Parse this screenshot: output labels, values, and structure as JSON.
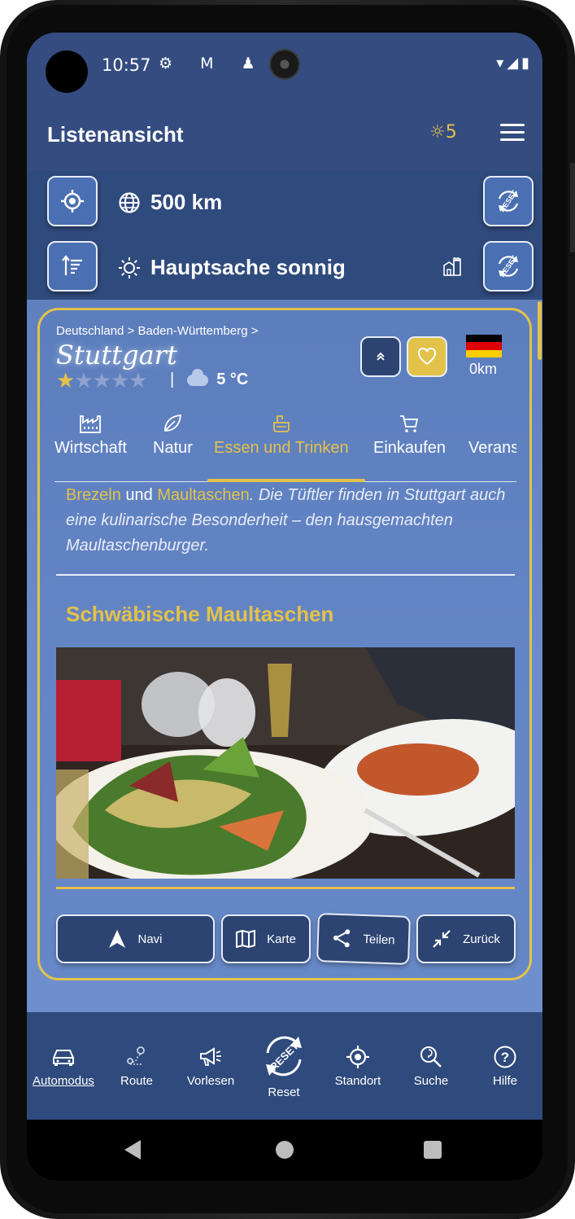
{
  "status_bar": {
    "time": "10:57",
    "left_icons": "⚙ M ♟ ♟",
    "right_icons": "▾◢▮"
  },
  "header": {
    "title": "Listenansicht",
    "sun_count": "5"
  },
  "filters": {
    "distance": "500 km",
    "weather": "Hauptsache sonnig",
    "reset_label": "RESET"
  },
  "place": {
    "breadcrumb": "Deutschland > Baden-Württemberg >",
    "city": "Stuttgart",
    "rating": 1,
    "rating_max": 5,
    "temperature": "5 °C",
    "distance": "0km"
  },
  "tabs": [
    {
      "label": "Wirtschaft",
      "icon": "factory-icon"
    },
    {
      "label": "Natur",
      "icon": "leaf-icon"
    },
    {
      "label": "Essen und Trinken",
      "icon": "food-icon",
      "active": true
    },
    {
      "label": "Einkaufen",
      "icon": "cart-icon"
    },
    {
      "label": "Verans",
      "icon": "event-icon"
    }
  ],
  "description": {
    "highlight1": "Brezeln",
    "and": "und",
    "highlight2": "Maultaschen",
    "text_rest": ". Die Tüftler finden in Stuttgart auch eine kulinarische Besonderheit – den hausgemachten Maultaschenburger."
  },
  "section_title": "Schwäbische Maultaschen",
  "actions": {
    "navi": "Navi",
    "karte": "Karte",
    "teilen": "Teilen",
    "zurueck": "Zurück"
  },
  "bottom_nav": [
    {
      "label": "Automodus",
      "icon": "car-icon"
    },
    {
      "label": "Route",
      "icon": "route-icon"
    },
    {
      "label": "Vorlesen",
      "icon": "megaphone-icon"
    },
    {
      "label": "Reset",
      "icon": "reset-icon"
    },
    {
      "label": "Standort",
      "icon": "location-target-icon"
    },
    {
      "label": "Suche",
      "icon": "search-icon"
    },
    {
      "label": "Hilfe",
      "icon": "help-icon"
    }
  ],
  "colors": {
    "accent": "#e3c24a",
    "primary": "#2f4a7c",
    "button": "#4a6fb2"
  }
}
